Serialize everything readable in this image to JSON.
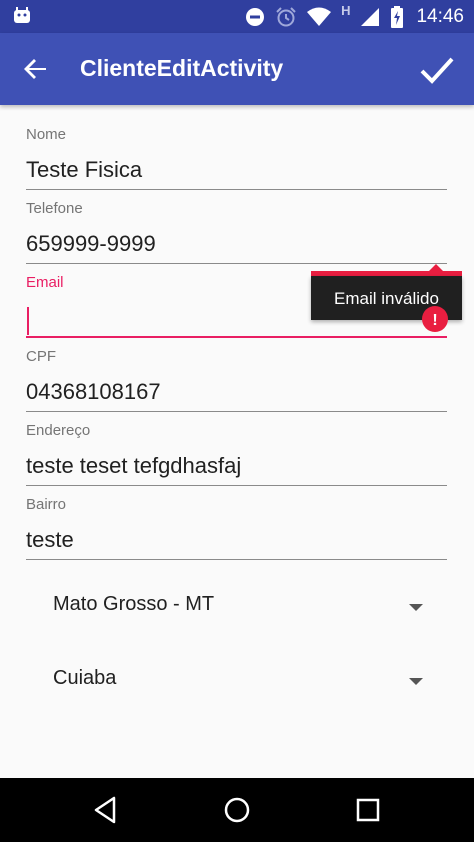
{
  "status_bar": {
    "time": "14:46",
    "network_letter": "H",
    "icons": [
      "android-debug-icon",
      "do-not-disturb-icon",
      "alarm-icon",
      "wifi-icon",
      "signal-icon",
      "battery-charging-icon"
    ]
  },
  "app_bar": {
    "title": "ClienteEditActivity",
    "back_icon": "arrow-back-icon",
    "action_icon": "check-icon"
  },
  "form": {
    "nome": {
      "label": "Nome",
      "value": "Teste Fisica"
    },
    "telefone": {
      "label": "Telefone",
      "value": "659999-9999"
    },
    "email": {
      "label": "Email",
      "value": "",
      "error": "Email inválido"
    },
    "cpf": {
      "label": "CPF",
      "value": "04368108167"
    },
    "endereco": {
      "label": "Endereço",
      "value": "teste teset tefgdhasfaj"
    },
    "bairro": {
      "label": "Bairro",
      "value": "teste"
    }
  },
  "spinners": {
    "estado": {
      "selected": "Mato Grosso - MT"
    },
    "cidade": {
      "selected": "Cuiaba"
    }
  },
  "colors": {
    "status_bar": "#303f9f",
    "app_bar": "#3f51b5",
    "accent_error": "#e91e63",
    "background": "#fafafa"
  },
  "nav_bar": {
    "icons": [
      "back-triangle-icon",
      "home-circle-icon",
      "recents-square-icon"
    ]
  }
}
